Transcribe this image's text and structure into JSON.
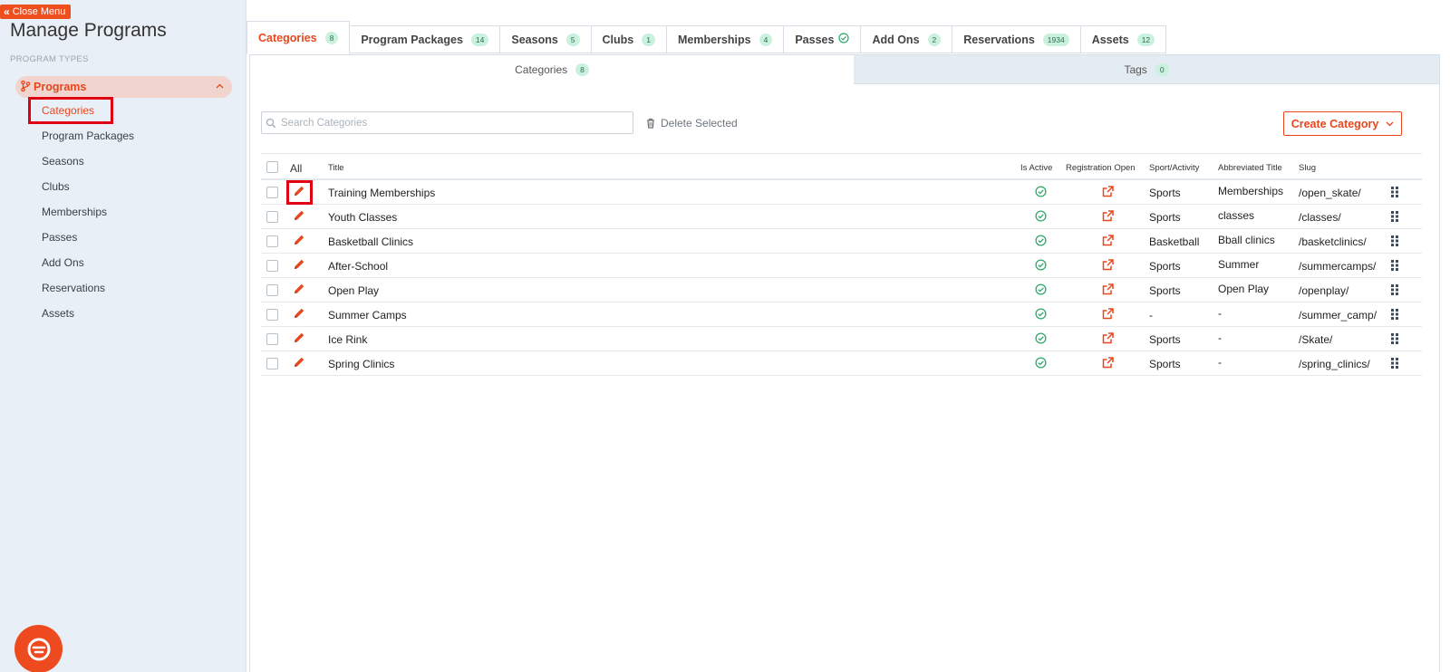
{
  "sidebar": {
    "close_menu": "Close Menu",
    "title": "Manage Programs",
    "section_label": "PROGRAM TYPES",
    "programs_label": "Programs",
    "items": [
      {
        "label": "Categories",
        "active": true
      },
      {
        "label": "Program Packages"
      },
      {
        "label": "Seasons"
      },
      {
        "label": "Clubs"
      },
      {
        "label": "Memberships"
      },
      {
        "label": "Passes"
      },
      {
        "label": "Add Ons"
      },
      {
        "label": "Reservations"
      },
      {
        "label": "Assets"
      }
    ]
  },
  "tabs": [
    {
      "label": "Categories",
      "badge": "8",
      "active": true
    },
    {
      "label": "Program Packages",
      "badge": "14"
    },
    {
      "label": "Seasons",
      "badge": "5"
    },
    {
      "label": "Clubs",
      "badge": "1"
    },
    {
      "label": "Memberships",
      "badge": "4"
    },
    {
      "label": "Passes",
      "icon": "check-circle-icon"
    },
    {
      "label": "Add Ons",
      "badge": "2"
    },
    {
      "label": "Reservations",
      "badge": "1934"
    },
    {
      "label": "Assets",
      "badge": "12"
    }
  ],
  "subtabs": [
    {
      "label": "Categories",
      "badge": "8",
      "active": true
    },
    {
      "label": "Tags",
      "badge": "0"
    }
  ],
  "toolbar": {
    "search_placeholder": "Search Categories",
    "delete_label": "Delete Selected",
    "create_label": "Create Category"
  },
  "table": {
    "headers": {
      "all": "All",
      "title": "Title",
      "is_active": "Is Active",
      "registration_open": "Registration Open",
      "sport": "Sport/Activity",
      "abbrev": "Abbreviated Title",
      "slug": "Slug"
    },
    "rows": [
      {
        "title": "Training Memberships",
        "sport": "Sports",
        "abbrev": "Memberships",
        "slug": "/open_skate/"
      },
      {
        "title": "Youth Classes",
        "sport": "Sports",
        "abbrev": "classes",
        "slug": "/classes/"
      },
      {
        "title": "Basketball Clinics",
        "sport": "Basketball",
        "abbrev": "Bball clinics",
        "slug": "/basketclinics/"
      },
      {
        "title": "After-School",
        "sport": "Sports",
        "abbrev": "Summer",
        "slug": "/summercamps/"
      },
      {
        "title": "Open Play",
        "sport": "Sports",
        "abbrev": "Open Play",
        "slug": "/openplay/"
      },
      {
        "title": "Summer Camps",
        "sport": "-",
        "abbrev": "-",
        "slug": "/summer_camp/"
      },
      {
        "title": "Ice Rink",
        "sport": "Sports",
        "abbrev": "-",
        "slug": "/Skate/"
      },
      {
        "title": "Spring Clinics",
        "sport": "Sports",
        "abbrev": "-",
        "slug": "/spring_clinics/"
      }
    ]
  },
  "colors": {
    "accent": "#e8461c",
    "success": "#2ea86a",
    "highlight": "#e00012"
  }
}
